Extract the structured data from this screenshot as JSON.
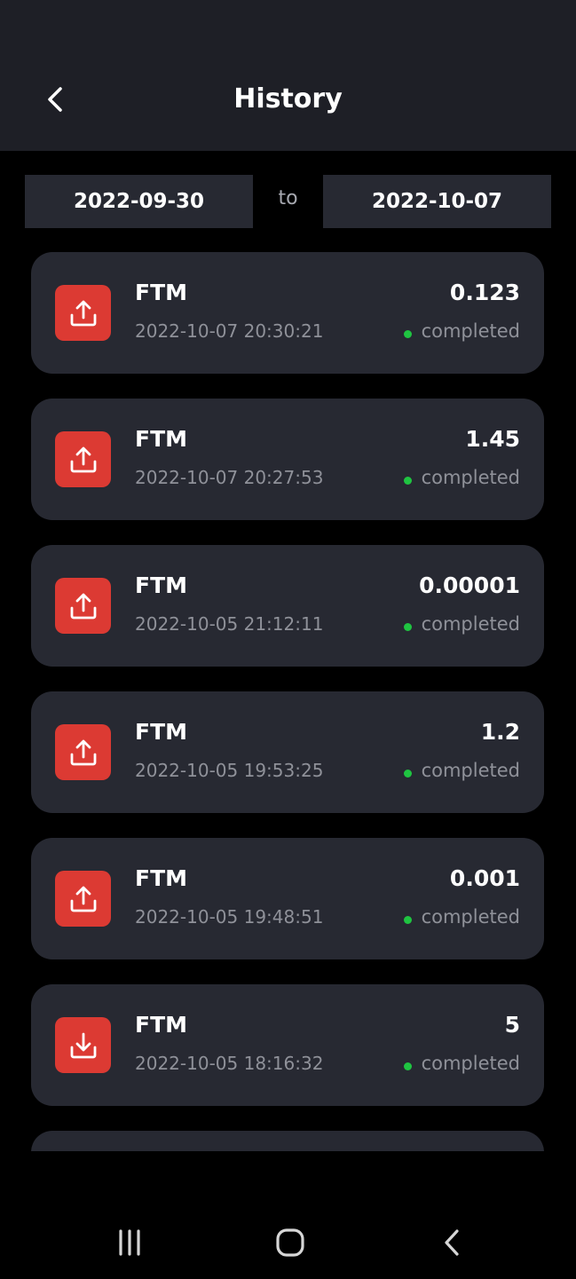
{
  "header": {
    "title": "History",
    "back_icon": "chevron-left-icon"
  },
  "date_range": {
    "from": "2022-09-30",
    "separator": "to",
    "to": "2022-10-07"
  },
  "colors": {
    "header_bg": "#1e1f26",
    "card_bg": "#272932",
    "icon_bg": "#dc3a33",
    "status_completed": "#1fc441",
    "muted_text": "#8f9199"
  },
  "transactions": [
    {
      "asset": "FTM",
      "time": "2022-10-07 20:30:21",
      "amount": "0.123",
      "status": "completed",
      "direction": "send",
      "icon": "upload-icon"
    },
    {
      "asset": "FTM",
      "time": "2022-10-07 20:27:53",
      "amount": "1.45",
      "status": "completed",
      "direction": "send",
      "icon": "upload-icon"
    },
    {
      "asset": "FTM",
      "time": "2022-10-05 21:12:11",
      "amount": "0.00001",
      "status": "completed",
      "direction": "send",
      "icon": "upload-icon"
    },
    {
      "asset": "FTM",
      "time": "2022-10-05 19:53:25",
      "amount": "1.2",
      "status": "completed",
      "direction": "send",
      "icon": "upload-icon"
    },
    {
      "asset": "FTM",
      "time": "2022-10-05 19:48:51",
      "amount": "0.001",
      "status": "completed",
      "direction": "send",
      "icon": "upload-icon"
    },
    {
      "asset": "FTM",
      "time": "2022-10-05 18:16:32",
      "amount": "5",
      "status": "completed",
      "direction": "receive",
      "icon": "download-icon"
    }
  ],
  "system_nav": {
    "recent_icon": "recent-apps-icon",
    "home_icon": "home-icon",
    "back_icon": "system-back-icon"
  }
}
